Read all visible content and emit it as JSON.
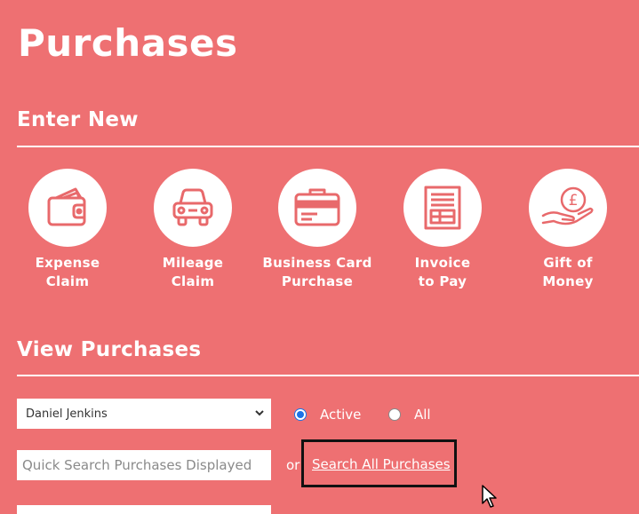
{
  "page": {
    "title": "Purchases"
  },
  "enter_new": {
    "heading": "Enter New",
    "tiles": [
      {
        "label": "Expense\nClaim",
        "icon": "wallet-icon"
      },
      {
        "label": "Mileage\nClaim",
        "icon": "car-icon"
      },
      {
        "label": "Business Card\nPurchase",
        "icon": "briefcase-icon"
      },
      {
        "label": "Invoice\nto Pay",
        "icon": "invoice-icon"
      },
      {
        "label": "Gift of\nMoney",
        "icon": "pound-coin-hand-icon"
      }
    ]
  },
  "view": {
    "heading": "View Purchases",
    "person_select": {
      "selected": "Daniel Jenkins"
    },
    "filter": {
      "active_label": "Active",
      "all_label": "All",
      "selected": "Active"
    },
    "quick_search": {
      "placeholder": "Quick Search Purchases Displayed",
      "value": ""
    },
    "or_text": "or",
    "search_all_label": "Search All Purchases"
  },
  "colors": {
    "background": "#ee7072",
    "icon": "#e8696b",
    "radio_accent": "#1a73e8"
  }
}
